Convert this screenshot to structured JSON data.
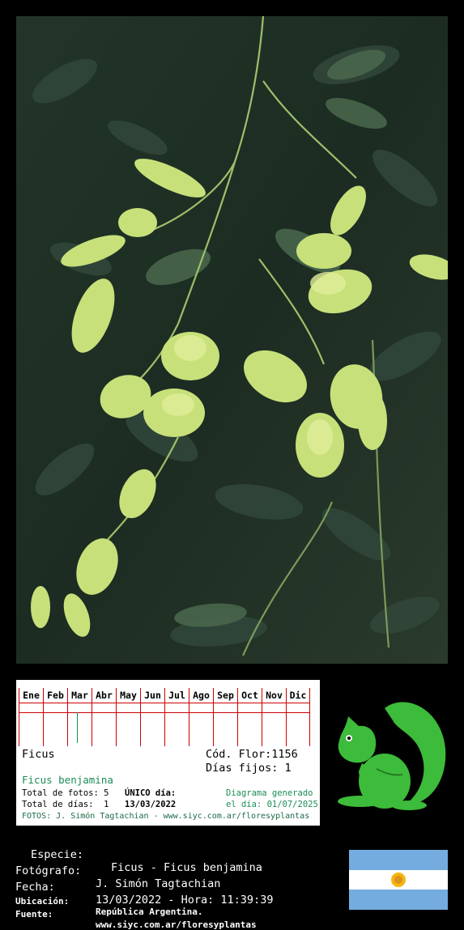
{
  "calendar": {
    "months": [
      "Ene",
      "Feb",
      "Mar",
      "Abr",
      "May",
      "Jun",
      "Jul",
      "Ago",
      "Sep",
      "Oct",
      "Nov",
      "Dic"
    ],
    "marked_month": "Mar"
  },
  "card": {
    "genus": "Ficus",
    "code_label": "Cód. Flor:1156",
    "fixed_days": "Días fijos: 1",
    "species": "Ficus benjamina",
    "total_photos": "Total de fotos: 5",
    "total_days": "Total de días:  1",
    "unique_day_label": "ÚNICO día:",
    "unique_day_value": "13/03/2022",
    "diagram_label": "Diagrama generado",
    "diagram_date": "el día: 01/07/2025",
    "credit": "FOTOS: J. Simón Tagtachian - www.siyc.com.ar/floresyplantas"
  },
  "info": {
    "species_label": "Especie:",
    "species_value": "Ficus - Ficus benjamina",
    "photographer_label": "Fotógrafo:",
    "photographer_value": "J. Simón Tagtachian",
    "date_label": "Fecha:",
    "date_value": "13/03/2022 - Hora: 11:39:39",
    "location_label": "Ubicación:",
    "location_value": "República Argentina.",
    "source_label": "Fuente:",
    "source_value": "www.siyc.com.ar/floresyplantas"
  },
  "colors": {
    "accent_green": "#1a8c55",
    "grid_red": "#cc0000",
    "logo_green": "#3dbb3a",
    "flag_blue": "#74acdf",
    "sun_gold": "#f6b40e"
  },
  "icons": {
    "logo": "green-squirrel-logo",
    "flag": "argentina-flag"
  }
}
